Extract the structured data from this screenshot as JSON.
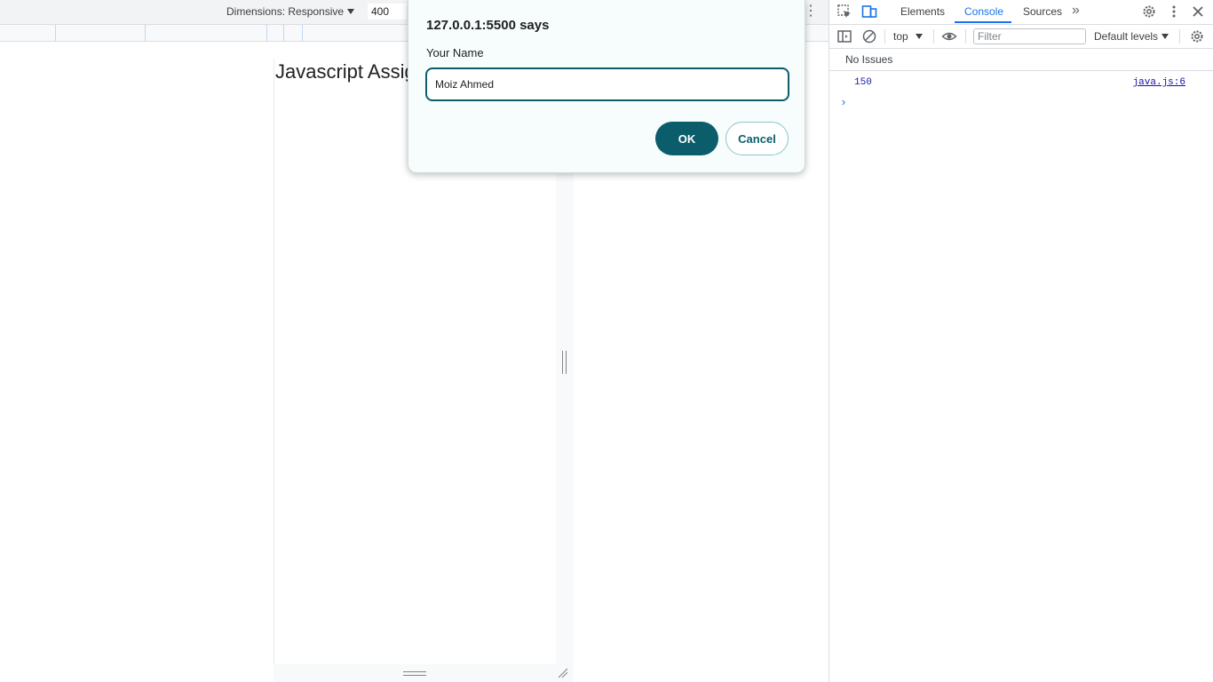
{
  "device_toolbar": {
    "dimensions_label": "Dimensions: Responsive",
    "width_value": "400",
    "more_glyph": "⋮"
  },
  "page": {
    "heading": "Javascript Assig"
  },
  "dialog": {
    "title": "127.0.0.1:5500 says",
    "message": "Your Name",
    "input_value": "Moiz Ahmed",
    "ok_label": "OK",
    "cancel_label": "Cancel",
    "accent_color": "#0b5d6b",
    "background_color": "#f6fdfc"
  },
  "devtools": {
    "tabs": [
      "Elements",
      "Console",
      "Sources"
    ],
    "active_tab": "Console",
    "more_tabs_glyph": "»",
    "context": "top",
    "filter_placeholder": "Filter",
    "levels_label": "Default levels",
    "issues_text": "No Issues",
    "console_messages": [
      {
        "value": "150",
        "source": "java.js:6"
      }
    ],
    "prompt_glyph": "›",
    "icons": [
      "inspect-element-icon",
      "device-toggle-icon",
      "more-tabs-icon",
      "settings-icon",
      "kebab-menu-icon",
      "close-icon",
      "sidebar-toggle-icon",
      "clear-console-icon",
      "eye-icon",
      "console-settings-icon"
    ]
  }
}
